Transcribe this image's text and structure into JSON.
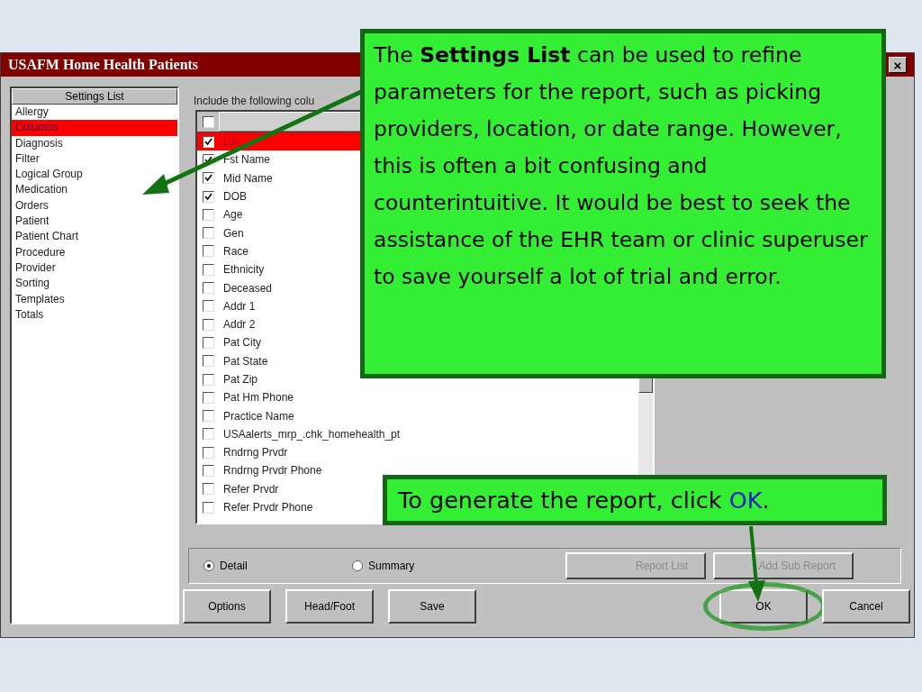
{
  "window": {
    "title": "USAFM Home Health Patients",
    "close": "×"
  },
  "settings_list": {
    "header": "Settings List",
    "items": [
      {
        "label": "Allergy",
        "selected": false
      },
      {
        "label": "Columns",
        "selected": true
      },
      {
        "label": "Diagnosis",
        "selected": false
      },
      {
        "label": "Filter",
        "selected": false
      },
      {
        "label": "Logical Group",
        "selected": false
      },
      {
        "label": "Medication",
        "selected": false
      },
      {
        "label": "Orders",
        "selected": false
      },
      {
        "label": "Patient",
        "selected": false
      },
      {
        "label": "Patient Chart",
        "selected": false
      },
      {
        "label": "Procedure",
        "selected": false
      },
      {
        "label": "Provider",
        "selected": false
      },
      {
        "label": "Sorting",
        "selected": false
      },
      {
        "label": "Templates",
        "selected": false
      },
      {
        "label": "Totals",
        "selected": false
      }
    ]
  },
  "columns": {
    "caption": "Include the following colu",
    "all_checked": false,
    "rows": [
      {
        "label": "Lst",
        "checked": true,
        "selected": true
      },
      {
        "label": "Fst Name",
        "checked": true,
        "selected": false
      },
      {
        "label": "Mid Name",
        "checked": true,
        "selected": false
      },
      {
        "label": "DOB",
        "checked": true,
        "selected": false
      },
      {
        "label": "Age",
        "checked": false,
        "selected": false
      },
      {
        "label": "Gen",
        "checked": false,
        "selected": false
      },
      {
        "label": "Race",
        "checked": false,
        "selected": false
      },
      {
        "label": "Ethnicity",
        "checked": false,
        "selected": false
      },
      {
        "label": "Deceased",
        "checked": false,
        "selected": false
      },
      {
        "label": "Addr 1",
        "checked": false,
        "selected": false
      },
      {
        "label": "Addr 2",
        "checked": false,
        "selected": false
      },
      {
        "label": "Pat City",
        "checked": false,
        "selected": false
      },
      {
        "label": "Pat State",
        "checked": false,
        "selected": false
      },
      {
        "label": "Pat Zip",
        "checked": false,
        "selected": false
      },
      {
        "label": "Pat Hm Phone",
        "checked": false,
        "selected": false
      },
      {
        "label": "Practice Name",
        "checked": false,
        "selected": false
      },
      {
        "label": "USAalerts_mrp_.chk_homehealth_pt",
        "checked": false,
        "selected": false
      },
      {
        "label": "Rndrng Prvdr",
        "checked": false,
        "selected": false
      },
      {
        "label": "Rndrng Prvdr Phone",
        "checked": false,
        "selected": false
      },
      {
        "label": "Refer Prvdr",
        "checked": false,
        "selected": false
      },
      {
        "label": "Refer Prvdr Phone",
        "checked": false,
        "selected": false
      }
    ]
  },
  "report_type": [
    {
      "label": "Detail",
      "selected": true
    },
    {
      "label": "Summary",
      "selected": false
    }
  ],
  "panel_buttons": [
    {
      "label": "Report List",
      "disabled": true
    },
    {
      "label": "Add Sub Report",
      "disabled": true
    }
  ],
  "buttons": [
    {
      "label": "Options",
      "highlighted": false
    },
    {
      "label": "Head/Foot",
      "highlighted": false
    },
    {
      "label": "Save",
      "highlighted": false
    },
    {
      "label": "OK",
      "highlighted": true
    },
    {
      "label": "Cancel",
      "highlighted": false
    }
  ],
  "callouts": [
    {
      "text": "The **Settings List** can be used to refine parameters for the report, such as picking providers, location, or date range.  However, this is often a bit confusing and counterintuitive.  It would be best to seek the assistance of the EHR team or clinic superuser to save yourself a lot of trial and error."
    },
    {
      "text": "To generate the report, click ",
      "accent": "OK",
      "end": "."
    }
  ]
}
